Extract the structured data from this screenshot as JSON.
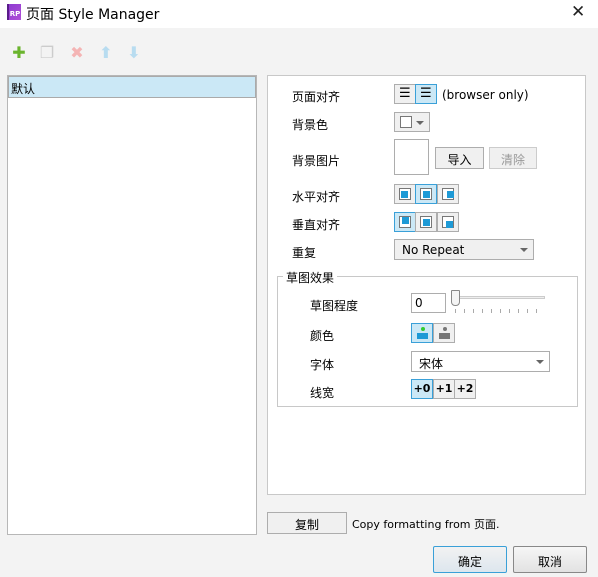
{
  "window": {
    "title": "页面 Style Manager",
    "logo": "RP"
  },
  "toolbar": {
    "items": [
      {
        "icon": "add-icon",
        "color": "#6ab42d"
      },
      {
        "icon": "duplicate-icon"
      },
      {
        "icon": "delete-icon"
      },
      {
        "icon": "move-up-icon"
      },
      {
        "icon": "move-down-icon"
      }
    ]
  },
  "styles": {
    "items": [
      "默认"
    ],
    "selected": "默认"
  },
  "props": {
    "page_align": {
      "label": "页面对齐",
      "note": "(browser only)",
      "selected": "center"
    },
    "bg_color": {
      "label": "背景色"
    },
    "bg_image": {
      "label": "背景图片",
      "import": "导入",
      "clear": "清除"
    },
    "h_align": {
      "label": "水平对齐",
      "selected": "center"
    },
    "v_align": {
      "label": "垂直对齐",
      "selected": "top"
    },
    "repeat": {
      "label": "重复",
      "value": "No Repeat"
    },
    "sketch": {
      "title": "草图效果",
      "level_label": "草图程度",
      "level": "0",
      "color_label": "颜色",
      "color_selected": "color",
      "font_label": "字体",
      "font": "宋体",
      "width_label": "线宽",
      "widths": [
        "+0",
        "+1",
        "+2"
      ],
      "width_selected": "+0"
    }
  },
  "footer": {
    "copy": "复制",
    "copy_text": "Copy formatting from 页面.",
    "ok": "确定",
    "cancel": "取消"
  },
  "accent": "#1e9ad6"
}
